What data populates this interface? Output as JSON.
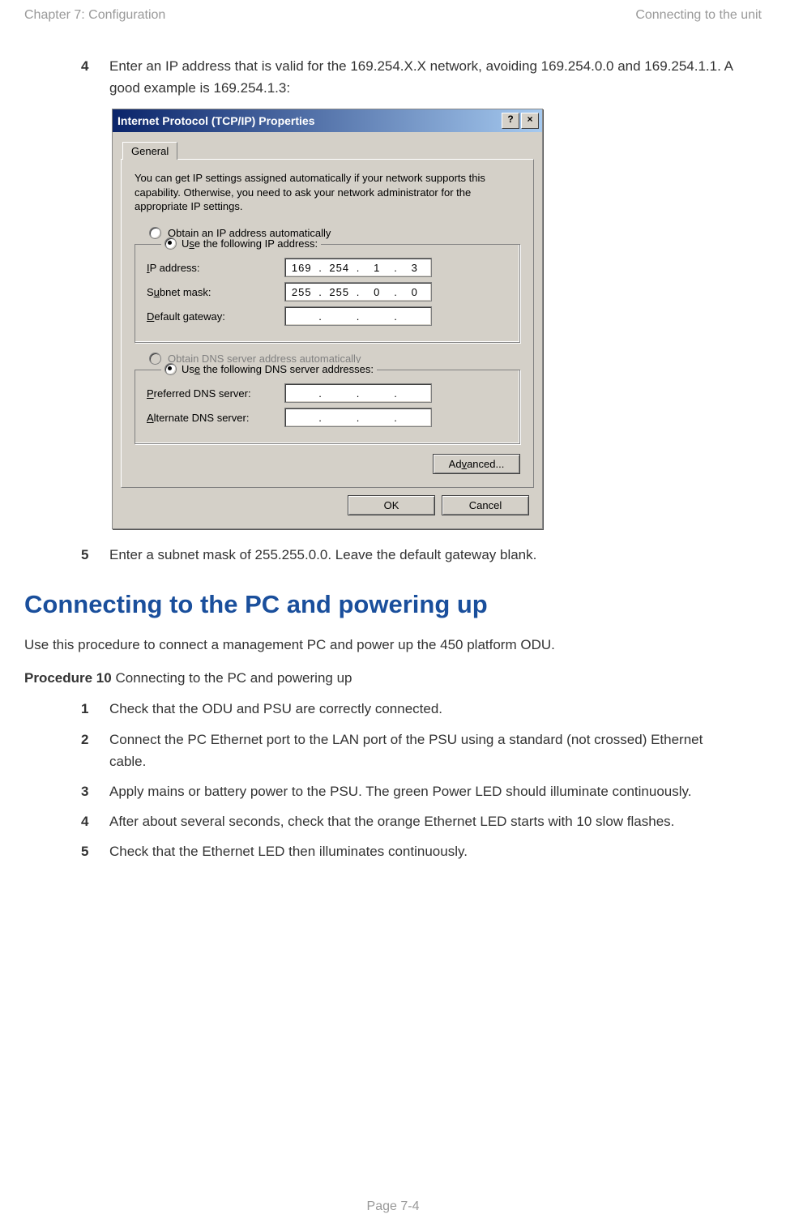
{
  "header": {
    "left": "Chapter 7:  Configuration",
    "right": "Connecting to the unit"
  },
  "top_steps": [
    {
      "num": "4",
      "text": "Enter an IP address that is valid for the 169.254.X.X network, avoiding 169.254.0.0 and 169.254.1.1. A good example is 169.254.1.3:"
    }
  ],
  "dialog": {
    "title": "Internet Protocol (TCP/IP) Properties",
    "help_btn": "?",
    "close_btn": "×",
    "tab": "General",
    "description": "You can get IP settings assigned automatically if your network supports this capability. Otherwise, you need to ask your network administrator for the appropriate IP settings.",
    "radio_obtain_ip": "Obtain an IP address automatically",
    "radio_use_ip": "Use the following IP address:",
    "ip_label": "IP address:",
    "ip_value": [
      "169",
      "254",
      "1",
      "3"
    ],
    "subnet_label": "Subnet mask:",
    "subnet_value": [
      "255",
      "255",
      "0",
      "0"
    ],
    "gateway_label": "Default gateway:",
    "gateway_value": [
      "",
      "",
      "",
      ""
    ],
    "radio_obtain_dns": "Obtain DNS server address automatically",
    "radio_use_dns": "Use the following DNS server addresses:",
    "pref_dns_label": "Preferred DNS server:",
    "pref_dns_value": [
      "",
      "",
      "",
      ""
    ],
    "alt_dns_label": "Alternate DNS server:",
    "alt_dns_value": [
      "",
      "",
      "",
      ""
    ],
    "advanced_btn": "Advanced...",
    "ok_btn": "OK",
    "cancel_btn": "Cancel"
  },
  "after_dialog_step": {
    "num": "5",
    "text": "Enter a subnet mask of 255.255.0.0. Leave the default gateway blank."
  },
  "section_heading": "Connecting to the PC and powering up",
  "section_intro": "Use this procedure to connect a management PC and power up the 450 platform ODU.",
  "procedure_label_bold": "Procedure 10",
  "procedure_label_rest": " Connecting to the PC and powering up",
  "procedure_steps": [
    {
      "num": "1",
      "text": "Check that the ODU and PSU are correctly connected."
    },
    {
      "num": "2",
      "text": "Connect the PC Ethernet port to the LAN port of the PSU using a standard (not crossed) Ethernet cable."
    },
    {
      "num": "3",
      "text": "Apply mains or battery power to the PSU. The green Power LED should illuminate continuously."
    },
    {
      "num": "4",
      "text": "After about several seconds, check that the orange Ethernet LED starts with 10 slow flashes."
    },
    {
      "num": "5",
      "text": "Check that the Ethernet LED then illuminates continuously."
    }
  ],
  "footer": "Page 7-4"
}
